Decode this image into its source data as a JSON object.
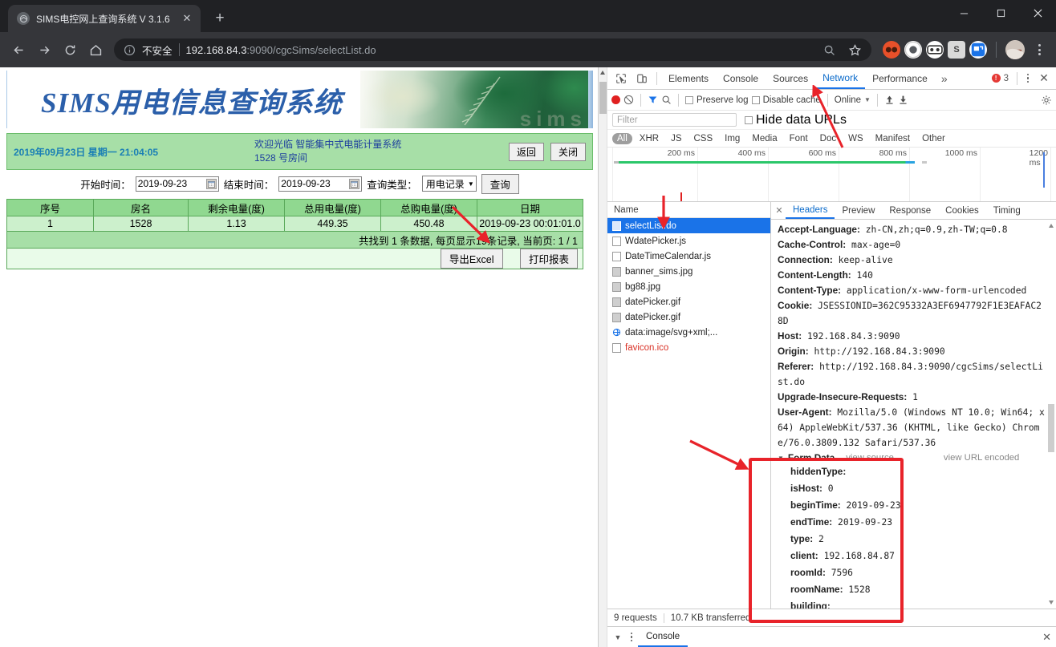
{
  "browser": {
    "tab": {
      "title": "SIMS电控网上查询系统 V 3.1.6",
      "close_label": "✕"
    },
    "newtab_label": "+",
    "window_controls": {
      "minimize": "minimize-icon",
      "maximize": "maximize-icon",
      "close": "close-icon"
    },
    "omnibox": {
      "security_text": "不安全",
      "url_host": "192.168.84.3",
      "url_rest": ":9090/cgcSims/selectList.do",
      "full_url": "192.168.84.3:9090/cgcSims/selectList.do"
    },
    "extensions": [
      {
        "name": "extension-red-icon",
        "glyph": "∞",
        "color": "#e8502a"
      },
      {
        "name": "extension-record-icon",
        "glyph": "●",
        "color": "#ffffff"
      },
      {
        "name": "extension-goggles-icon",
        "glyph": "◻",
        "color": "#ffffff"
      },
      {
        "name": "extension-s-icon",
        "glyph": "S",
        "color": "#d9d9d9"
      },
      {
        "name": "extension-blue-icon",
        "glyph": "⇲",
        "color": "#ffffff"
      }
    ]
  },
  "page": {
    "banner_title": "SIMS用电信息查询系统",
    "banner_ghost_text": "sims",
    "status_bar": {
      "datetime": "2019年09月23日 星期一 21:04:05",
      "welcome_line1": "欢迎光临 智能集中式电能计量系统",
      "welcome_line2": "1528 号房间",
      "back_button": "返回",
      "close_button": "关闭"
    },
    "form": {
      "begin_label": "开始时间：",
      "begin_value": "2019-09-23",
      "end_label": "结束时间：",
      "end_value": "2019-09-23",
      "type_label": "查询类型：",
      "type_value": "用电记录",
      "query_button": "查询"
    },
    "table": {
      "headers": [
        "序号",
        "房名",
        "剩余电量(度)",
        "总用电量(度)",
        "总购电量(度)",
        "日期"
      ],
      "rows": [
        [
          "1",
          "1528",
          "1.13",
          "449.35",
          "450.48",
          "2019-09-23 00:01:01.0"
        ]
      ],
      "summary": "共找到 1 条数据, 每页显示19条记录, 当前页: 1 / 1",
      "export_button": "导出Excel",
      "print_button": "打印报表"
    }
  },
  "devtools": {
    "tabs": [
      {
        "label": "Elements",
        "active": false
      },
      {
        "label": "Console",
        "active": false
      },
      {
        "label": "Sources",
        "active": false
      },
      {
        "label": "Network",
        "active": true
      },
      {
        "label": "Performance",
        "active": false
      }
    ],
    "more_label": "»",
    "error_count": "3",
    "toolbar": {
      "preserve_log": "Preserve log",
      "disable_cache": "Disable cache",
      "throttle": "Online"
    },
    "filter": {
      "placeholder": "Filter",
      "hide_data_urls": "Hide data URLs",
      "types": [
        {
          "label": "All",
          "active": true
        },
        {
          "label": "XHR",
          "active": false
        },
        {
          "label": "JS",
          "active": false
        },
        {
          "label": "CSS",
          "active": false
        },
        {
          "label": "Img",
          "active": false
        },
        {
          "label": "Media",
          "active": false
        },
        {
          "label": "Font",
          "active": false
        },
        {
          "label": "Doc",
          "active": false
        },
        {
          "label": "WS",
          "active": false
        },
        {
          "label": "Manifest",
          "active": false
        },
        {
          "label": "Other",
          "active": false
        }
      ]
    },
    "overview": {
      "ticks": [
        "200 ms",
        "400 ms",
        "600 ms",
        "800 ms",
        "1000 ms",
        "1200 ms"
      ]
    },
    "requests": {
      "column_header": "Name",
      "items": [
        {
          "name": "selectList.do",
          "icon": "doc-icon",
          "selected": true,
          "error": false
        },
        {
          "name": "WdatePicker.js",
          "icon": "script-icon",
          "selected": false,
          "error": false
        },
        {
          "name": "DateTimeCalendar.js",
          "icon": "script-icon",
          "selected": false,
          "error": false
        },
        {
          "name": "banner_sims.jpg",
          "icon": "image-icon",
          "selected": false,
          "error": false
        },
        {
          "name": "bg88.jpg",
          "icon": "image-icon",
          "selected": false,
          "error": false
        },
        {
          "name": "datePicker.gif",
          "icon": "image-icon",
          "selected": false,
          "error": false
        },
        {
          "name": "datePicker.gif",
          "icon": "image-icon",
          "selected": false,
          "error": false
        },
        {
          "name": "data:image/svg+xml;...",
          "icon": "svg-icon",
          "selected": false,
          "error": false
        },
        {
          "name": "favicon.ico",
          "icon": "doc-icon",
          "selected": false,
          "error": true
        }
      ]
    },
    "detail": {
      "tabs": [
        {
          "label": "Headers",
          "active": true
        },
        {
          "label": "Preview",
          "active": false
        },
        {
          "label": "Response",
          "active": false
        },
        {
          "label": "Cookies",
          "active": false
        },
        {
          "label": "Timing",
          "active": false
        }
      ],
      "headers": [
        {
          "key": "Accept-Language:",
          "value": "zh-CN,zh;q=0.9,zh-TW;q=0.8"
        },
        {
          "key": "Cache-Control:",
          "value": "max-age=0"
        },
        {
          "key": "Connection:",
          "value": "keep-alive"
        },
        {
          "key": "Content-Length:",
          "value": "140"
        },
        {
          "key": "Content-Type:",
          "value": "application/x-www-form-urlencoded"
        },
        {
          "key": "Cookie:",
          "value": "JSESSIONID=362C95332A3EF6947792F1E3EAFAC28D"
        },
        {
          "key": "Host:",
          "value": "192.168.84.3:9090"
        },
        {
          "key": "Origin:",
          "value": "http://192.168.84.3:9090"
        },
        {
          "key": "Referer:",
          "value": "http://192.168.84.3:9090/cgcSims/selectList.do"
        },
        {
          "key": "Upgrade-Insecure-Requests:",
          "value": "1"
        },
        {
          "key": "User-Agent:",
          "value": "Mozilla/5.0 (Windows NT 10.0; Win64; x64) AppleWebKit/537.36 (KHTML, like Gecko) Chrome/76.0.3809.132 Safari/537.36"
        }
      ],
      "form_data": {
        "title": "Form Data",
        "view_source": "view source",
        "view_url_encoded": "view URL encoded",
        "fields": [
          {
            "key": "hiddenType:",
            "value": ""
          },
          {
            "key": "isHost:",
            "value": "0"
          },
          {
            "key": "beginTime:",
            "value": "2019-09-23"
          },
          {
            "key": "endTime:",
            "value": "2019-09-23"
          },
          {
            "key": "type:",
            "value": "2"
          },
          {
            "key": "client:",
            "value": "192.168.84.87"
          },
          {
            "key": "roomId:",
            "value": "7596"
          },
          {
            "key": "roomName:",
            "value": "1528"
          },
          {
            "key": "building:",
            "value": ""
          }
        ]
      }
    },
    "status": {
      "requests": "9 requests",
      "transferred": "10.7 KB transferred"
    },
    "console_drawer": {
      "tab": "Console"
    }
  },
  "colors": {
    "accent_blue": "#1a73e8",
    "table_header_green": "#90d890",
    "table_row_green": "#ccf0cc",
    "bar_green": "#a7dfa7",
    "annotation_red": "#e8232a",
    "chrome_dark": "#202124",
    "toolbar_dark": "#35363a"
  }
}
